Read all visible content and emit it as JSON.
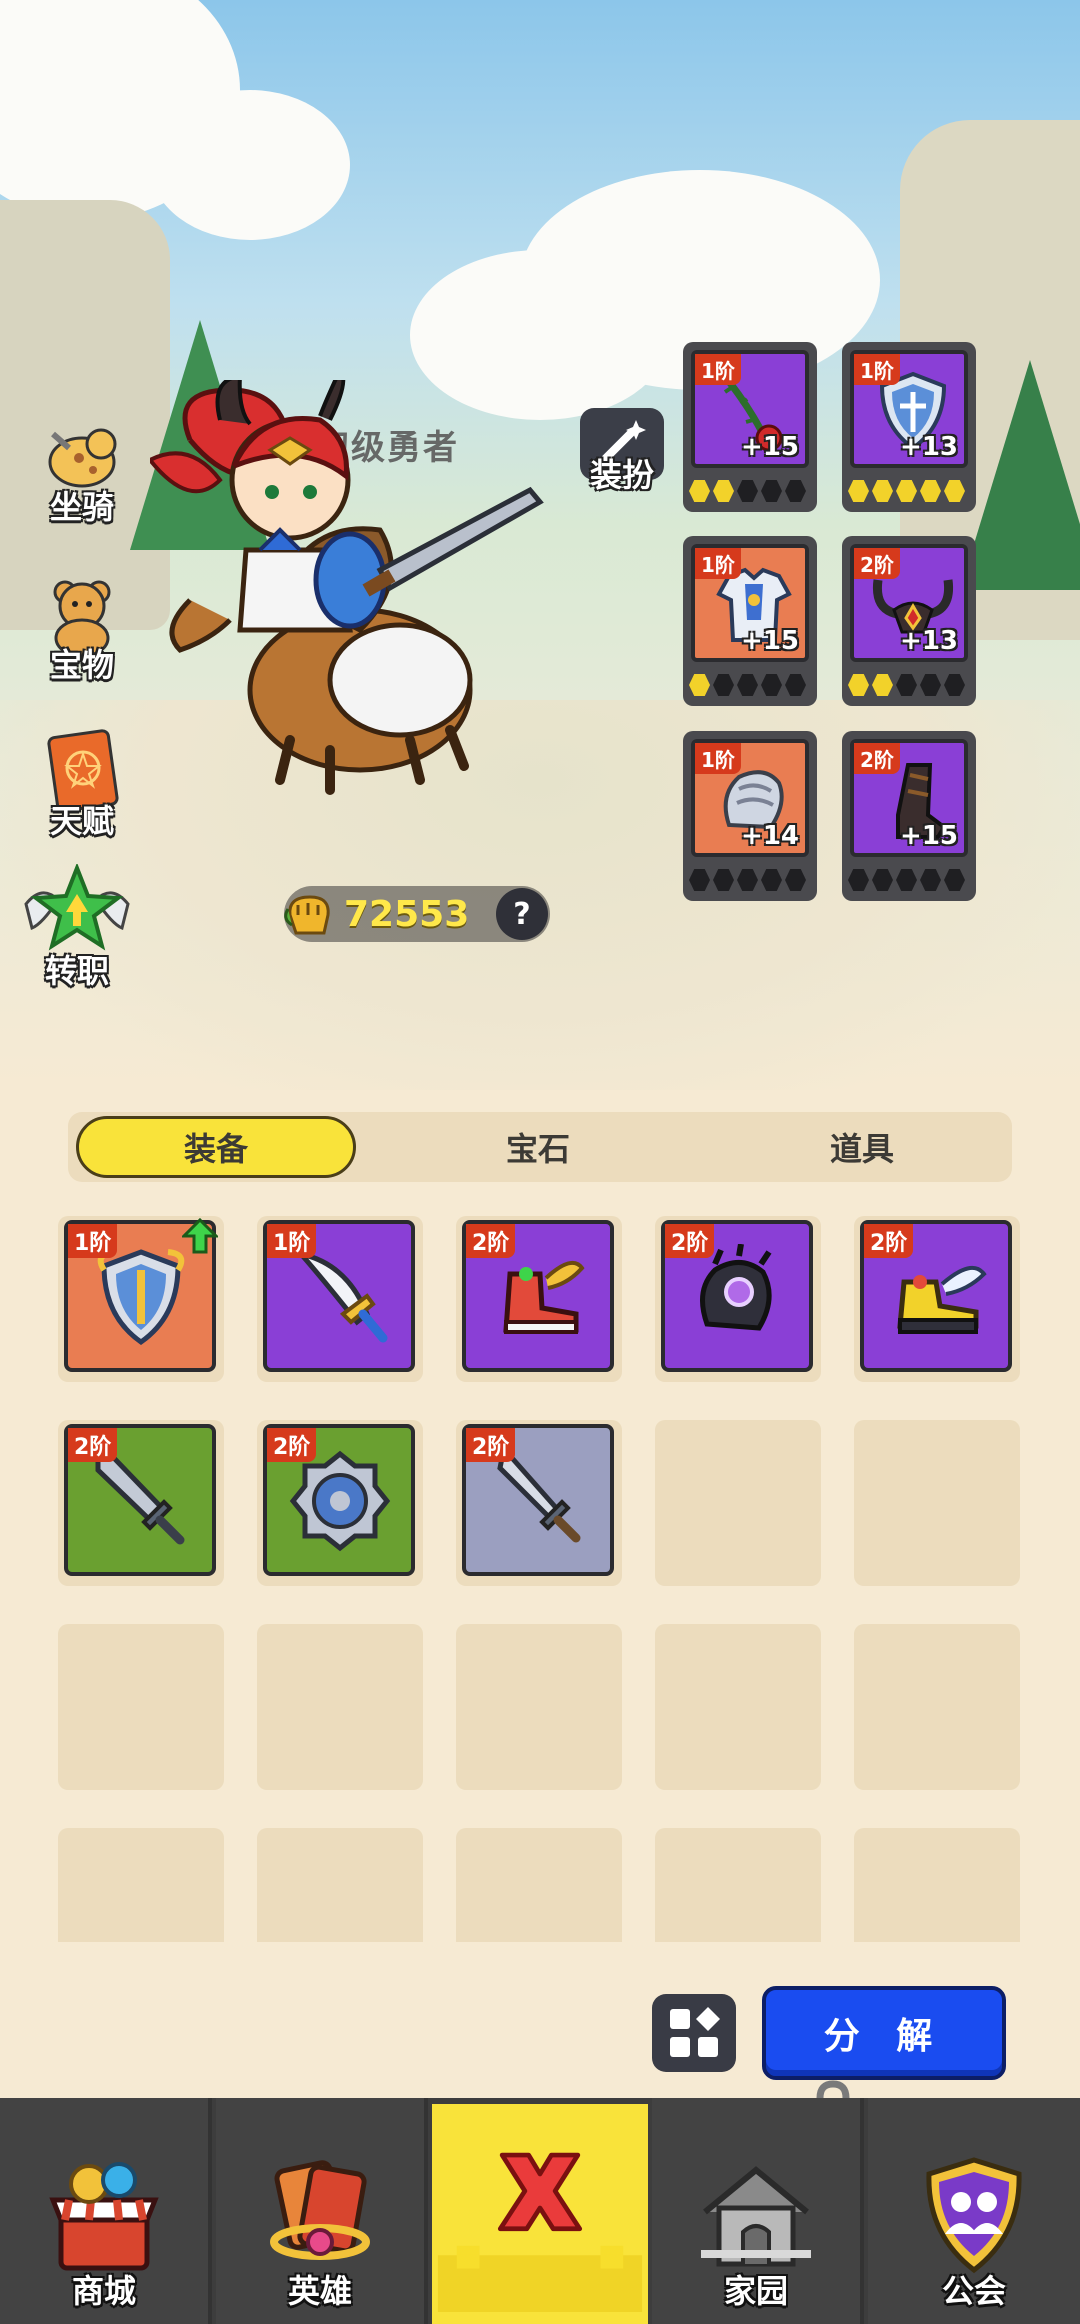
{
  "side_menu": {
    "mount": "坐骑",
    "treasure": "宝物",
    "talent": "天赋",
    "job_change": "转职"
  },
  "hero": {
    "title": "初级勇者",
    "dress_label": "装扮",
    "power": "72553",
    "help": "?"
  },
  "equipped": [
    {
      "tier": "1阶",
      "plus": "+15",
      "rarity": "purple",
      "icon": "rose-whip-icon",
      "stars_filled": 2
    },
    {
      "tier": "1阶",
      "plus": "+13",
      "rarity": "purple",
      "icon": "shield-icon",
      "stars_filled": 5
    },
    {
      "tier": "1阶",
      "plus": "+15",
      "rarity": "orange",
      "icon": "armor-icon",
      "stars_filled": 1
    },
    {
      "tier": "2阶",
      "plus": "+13",
      "rarity": "purple",
      "icon": "horned-helmet-icon",
      "stars_filled": 2
    },
    {
      "tier": "1阶",
      "plus": "+14",
      "rarity": "orange",
      "icon": "gauntlet-icon",
      "stars_filled": 0
    },
    {
      "tier": "2阶",
      "plus": "+15",
      "rarity": "purple",
      "icon": "boot-icon",
      "stars_filled": 0
    }
  ],
  "tabs": [
    "装备",
    "宝石",
    "道具"
  ],
  "inventory": [
    {
      "tier": "1阶",
      "rarity": "orange",
      "icon": "shield-icon",
      "upgrade": true
    },
    {
      "tier": "1阶",
      "rarity": "purple",
      "icon": "sword-icon",
      "upgrade": false
    },
    {
      "tier": "2阶",
      "rarity": "purple",
      "icon": "winged-boot-red-icon",
      "upgrade": false
    },
    {
      "tier": "2阶",
      "rarity": "purple",
      "icon": "dark-gauntlet-icon",
      "upgrade": false
    },
    {
      "tier": "2阶",
      "rarity": "purple",
      "icon": "winged-boot-yellow-icon",
      "upgrade": false
    },
    {
      "tier": "2阶",
      "rarity": "green",
      "icon": "broadsword-icon",
      "upgrade": false
    },
    {
      "tier": "2阶",
      "rarity": "green",
      "icon": "round-shield-icon",
      "upgrade": false
    },
    {
      "tier": "2阶",
      "rarity": "grey",
      "icon": "sword-icon",
      "upgrade": false
    }
  ],
  "actions": {
    "decompose": "分 解"
  },
  "nav": {
    "shop": "商城",
    "heroes": "英雄",
    "home": "家园",
    "guild": "公会"
  }
}
